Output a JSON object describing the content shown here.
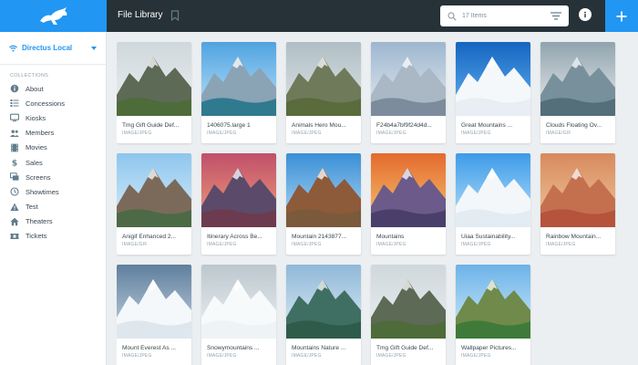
{
  "sidebar": {
    "project": "Directus Local",
    "section": "COLLECTIONS",
    "items": [
      {
        "label": "About",
        "icon": "info-icon"
      },
      {
        "label": "Concessions",
        "icon": "list-icon"
      },
      {
        "label": "Kiosks",
        "icon": "monitor-icon"
      },
      {
        "label": "Members",
        "icon": "people-icon"
      },
      {
        "label": "Movies",
        "icon": "film-icon"
      },
      {
        "label": "Sales",
        "icon": "dollar-icon"
      },
      {
        "label": "Screens",
        "icon": "screens-icon"
      },
      {
        "label": "Showtimes",
        "icon": "clock-icon"
      },
      {
        "label": "Test",
        "icon": "warning-icon"
      },
      {
        "label": "Theaters",
        "icon": "home-icon"
      },
      {
        "label": "Tickets",
        "icon": "ticket-icon"
      }
    ]
  },
  "header": {
    "title": "File Library",
    "search_placeholder": "17 Items"
  },
  "colors": {
    "accent": "#2196f3",
    "header": "#263238",
    "background": "#eceff1"
  },
  "files": [
    {
      "title": "Tmg Gift Guide Def...",
      "type": "IMAGE/JPEG"
    },
    {
      "title": "1406075.large 1",
      "type": "IMAGE/JPEG"
    },
    {
      "title": "Animals Hero Mou...",
      "type": "IMAGE/JPEG"
    },
    {
      "title": "F24b4a7bf9f24d4d...",
      "type": "IMAGE/JPEG"
    },
    {
      "title": "Great Mountains ...",
      "type": "IMAGE/JPEG"
    },
    {
      "title": "Clouds Floating Ov...",
      "type": "IMAGE/GIF"
    },
    {
      "title": "Anigif Enhanced 2...",
      "type": "IMAGE/GIF"
    },
    {
      "title": "Itinerary Across Be...",
      "type": "IMAGE/JPEG"
    },
    {
      "title": "Mountain 2143877...",
      "type": "IMAGE/JPEG"
    },
    {
      "title": "Mountains",
      "type": "IMAGE/JPEG"
    },
    {
      "title": "Uiaa Sustainability...",
      "type": "IMAGE/JPEG"
    },
    {
      "title": "Rainbow Mountain...",
      "type": "IMAGE/JPEG"
    },
    {
      "title": "Mount Everest As ...",
      "type": "IMAGE/JPEG"
    },
    {
      "title": "Snowymountains ...",
      "type": "IMAGE/JPEG"
    },
    {
      "title": "Mountains Nature ...",
      "type": "IMAGE/JPEG"
    },
    {
      "title": "Tmg Gift Guide Def...",
      "type": "IMAGE/JPEG"
    },
    {
      "title": "Wallpaper Pictures...",
      "type": "IMAGE/JPEG"
    }
  ]
}
